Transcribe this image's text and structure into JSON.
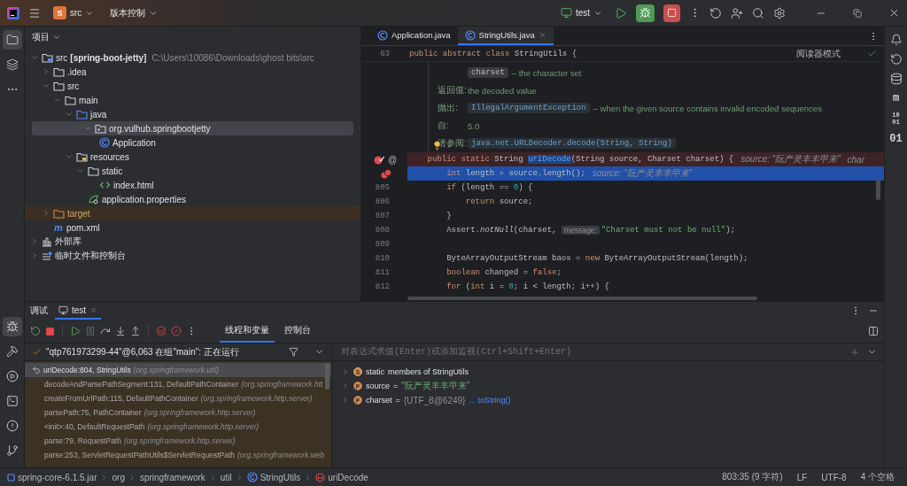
{
  "title_bar": {
    "project_badge": "S",
    "project": "src",
    "vcs": "版本控制",
    "run_config": "test"
  },
  "left_tools_top": [
    {
      "kind": "project",
      "selected": true
    },
    {
      "kind": "structure",
      "selected": false
    },
    {
      "kind": "more",
      "selected": false
    }
  ],
  "left_tools_bottom": [
    {
      "kind": "debug",
      "selected": true
    },
    {
      "kind": "build",
      "selected": false
    },
    {
      "kind": "services",
      "selected": false
    },
    {
      "kind": "terminal",
      "selected": false
    },
    {
      "kind": "problems",
      "selected": false
    },
    {
      "kind": "git",
      "selected": false
    }
  ],
  "project_panel": {
    "title": "项目",
    "tree": [
      {
        "name": "src",
        "module": "[spring-boot-jetty]",
        "path": "C:\\Users\\10086\\Downloads\\ghost bits\\src",
        "kind": "module",
        "expanded": true,
        "selected": false,
        "children": [
          {
            "name": ".idea",
            "kind": "folder",
            "expanded": false,
            "selected": false
          },
          {
            "name": "src",
            "kind": "folder",
            "expanded": true,
            "selected": false,
            "children": [
              {
                "name": "main",
                "kind": "folder",
                "expanded": true,
                "selected": false,
                "children": [
                  {
                    "name": "java",
                    "kind": "source-folder",
                    "expanded": true,
                    "selected": false,
                    "children": [
                      {
                        "name": "org.vulhub.springbootjetty",
                        "kind": "package",
                        "expanded": true,
                        "selected": true,
                        "children": [
                          {
                            "name": "Application",
                            "kind": "class",
                            "selected": false
                          }
                        ]
                      }
                    ]
                  },
                  {
                    "name": "resources",
                    "kind": "resources-folder",
                    "expanded": true,
                    "selected": false,
                    "children": [
                      {
                        "name": "static",
                        "kind": "folder",
                        "expanded": true,
                        "selected": false,
                        "children": [
                          {
                            "name": "index.html",
                            "kind": "html",
                            "selected": false
                          }
                        ]
                      },
                      {
                        "name": "application.properties",
                        "kind": "properties",
                        "selected": false
                      }
                    ]
                  }
                ]
              }
            ]
          },
          {
            "name": "target",
            "kind": "excluded-folder",
            "expanded": false,
            "selected": false
          },
          {
            "name": "pom.xml",
            "kind": "maven",
            "glyph": "m",
            "selected": false
          }
        ]
      },
      {
        "name": "外部库",
        "kind": "library",
        "expanded": false,
        "selected": false
      },
      {
        "name": "临时文件和控制台",
        "kind": "scratches",
        "expanded": false,
        "selected": false
      }
    ]
  },
  "editor": {
    "tabs": [
      {
        "label": "Application.java",
        "selected": false
      },
      {
        "label": "StringUtils.java",
        "selected": true
      }
    ],
    "sticky": {
      "number": "63",
      "tokens": [
        {
          "kind": "kw",
          "s": "public abstract class "
        },
        {
          "kind": "plain",
          "s": "StringUtils {"
        }
      ]
    },
    "reader_mode": "阅读器模式",
    "doc": [
      {
        "code": "charset",
        "kind": "param",
        "text": "– the character set"
      },
      {
        "label": "返回值:",
        "text": "the decoded value"
      },
      {
        "label": "抛出:",
        "code": "IllegalArgumentException",
        "kind": "link",
        "text": "– when the given source contains invalid encoded sequences"
      },
      {
        "label": "自:",
        "text": "5.0"
      },
      {
        "label": "请参阅:",
        "code": "java.net.URLDecoder.decode(String, String)",
        "kind": "link"
      }
    ],
    "lines": [
      {
        "kind": "breakpoint",
        "gutter": [
          {
            "kind": "breakpoint"
          },
          {
            "kind": "glyph",
            "text": "@"
          }
        ],
        "tokens": [
          {
            "kind": "kw",
            "s": "    public static "
          },
          {
            "kind": "plain",
            "s": "String "
          },
          {
            "kind": "sel",
            "s": "uriDecode"
          },
          {
            "kind": "plain",
            "s": "(String source, Charset charset) {"
          }
        ],
        "hints": [
          "source: “阮产灵丰丰甲来”",
          "char"
        ]
      },
      {
        "kind": "execution",
        "gutter": [
          {
            "kind": "double-breakpoint"
          }
        ],
        "tokens": [
          {
            "kind": "kw",
            "s": "        int "
          },
          {
            "kind": "plain",
            "s": "length = source.length();"
          }
        ],
        "hints": [
          "source: “阮产灵丰丰甲来”"
        ]
      },
      {
        "kind": "normal",
        "number": "805",
        "tokens": [
          {
            "kind": "kw",
            "s": "        if "
          },
          {
            "kind": "plain",
            "s": "(length == "
          },
          {
            "kind": "num",
            "s": "0"
          },
          {
            "kind": "plain",
            "s": ") {"
          }
        ]
      },
      {
        "kind": "normal",
        "number": "806",
        "tokens": [
          {
            "kind": "kw",
            "s": "            return "
          },
          {
            "kind": "plain",
            "s": "source;"
          }
        ]
      },
      {
        "kind": "normal",
        "number": "807",
        "tokens": [
          {
            "kind": "plain",
            "s": "        }"
          }
        ]
      },
      {
        "kind": "normal",
        "number": "808",
        "tokens": [
          {
            "kind": "plain",
            "s": "        Assert."
          },
          {
            "kind": "call",
            "s": "notNull"
          },
          {
            "kind": "plain",
            "s": "(charset, "
          },
          {
            "kind": "param",
            "s": "message:"
          },
          {
            "kind": "str",
            "s": "\"Charset must not be null\""
          },
          {
            "kind": "plain",
            "s": ");"
          }
        ]
      },
      {
        "kind": "normal",
        "number": "809"
      },
      {
        "kind": "normal",
        "number": "810",
        "tokens": [
          {
            "kind": "plain",
            "s": "        ByteArrayOutputStream baos = "
          },
          {
            "kind": "kw",
            "s": "new "
          },
          {
            "kind": "plain",
            "s": "ByteArrayOutputStream(length);"
          }
        ]
      },
      {
        "kind": "normal",
        "number": "811",
        "tokens": [
          {
            "kind": "kw",
            "s": "        boolean "
          },
          {
            "kind": "plain",
            "s": "changed = "
          },
          {
            "kind": "kw",
            "s": "false"
          },
          {
            "kind": "plain",
            "s": ";"
          }
        ]
      },
      {
        "kind": "normal",
        "number": "812",
        "tokens": [
          {
            "kind": "kw",
            "s": "        for "
          },
          {
            "kind": "plain",
            "s": "("
          },
          {
            "kind": "kw",
            "s": "int "
          },
          {
            "kind": "plain",
            "s": "i = "
          },
          {
            "kind": "num",
            "s": "0"
          },
          {
            "kind": "plain",
            "s": "; i < length; i++) {"
          }
        ]
      }
    ]
  },
  "right_tools": [
    {
      "kind": "bell"
    },
    {
      "kind": "ai"
    },
    {
      "kind": "database"
    },
    {
      "kind": "glyph",
      "text": "m"
    },
    {
      "kind": "small-glyph",
      "text": "10 01"
    },
    {
      "kind": "glyph",
      "text": "01"
    }
  ],
  "debug": {
    "title": "调试",
    "tabs": [
      {
        "label": "test",
        "selected": true
      }
    ],
    "subtabs": [
      {
        "label": "线程和变量",
        "selected": true
      },
      {
        "label": "控制台",
        "selected": false
      }
    ],
    "thread": "\"qtp761973299-44\"@6,063 在组\"main\": 正在运行",
    "eval_placeholder": "对表达式求值(Enter)或添加监视(Ctrl+Shift+Enter)",
    "frames": [
      {
        "method": "uriDecode:804, StringUtils",
        "package": "(org.springframework.util)",
        "selected": true
      },
      {
        "method": "decodeAndParsePathSegment:131, DefaultPathContainer",
        "package": "(org.springframework.htt",
        "selected": false
      },
      {
        "method": "createFromUrlPath:115, DefaultPathContainer",
        "package": "(org.springframework.http.server)",
        "selected": false
      },
      {
        "method": "parsePath:75, PathContainer",
        "package": "(org.springframework.http.server)",
        "selected": false
      },
      {
        "method": "<init>:40, DefaultRequestPath",
        "package": "(org.springframework.http.server)",
        "selected": false
      },
      {
        "method": "parse:79, RequestPath",
        "package": "(org.springframework.http.server)",
        "selected": false
      },
      {
        "method": "parse:253, ServletRequestPathUtils$ServletRequestPath",
        "package": "(org.springframework.web",
        "selected": false
      }
    ],
    "variables": [
      {
        "kind": "static",
        "marker": "S",
        "expanded": false,
        "name": "static",
        "value": "members of StringUtils"
      },
      {
        "kind": "param",
        "marker": "P",
        "expanded": false,
        "name": "source",
        "sep": "=",
        "value": "\"阮产灵丰丰甲来\""
      },
      {
        "kind": "param",
        "marker": "P",
        "expanded": false,
        "name": "charset",
        "sep": "=",
        "value": "{UTF_8@6249}",
        "link": "... toString()"
      }
    ]
  },
  "status_bar": {
    "breadcrumbs": [
      {
        "kind": "jar",
        "label": "spring-core-6.1.5.jar"
      },
      {
        "kind": "package",
        "label": "org"
      },
      {
        "kind": "package",
        "label": "springframework"
      },
      {
        "kind": "package",
        "label": "util"
      },
      {
        "kind": "class",
        "label": "StringUtils"
      },
      {
        "kind": "method",
        "label": "uriDecode"
      }
    ],
    "position": "803:35 (9 字符)",
    "line_ending": "LF",
    "encoding": "UTF-8",
    "indent": "4 个空格"
  }
}
